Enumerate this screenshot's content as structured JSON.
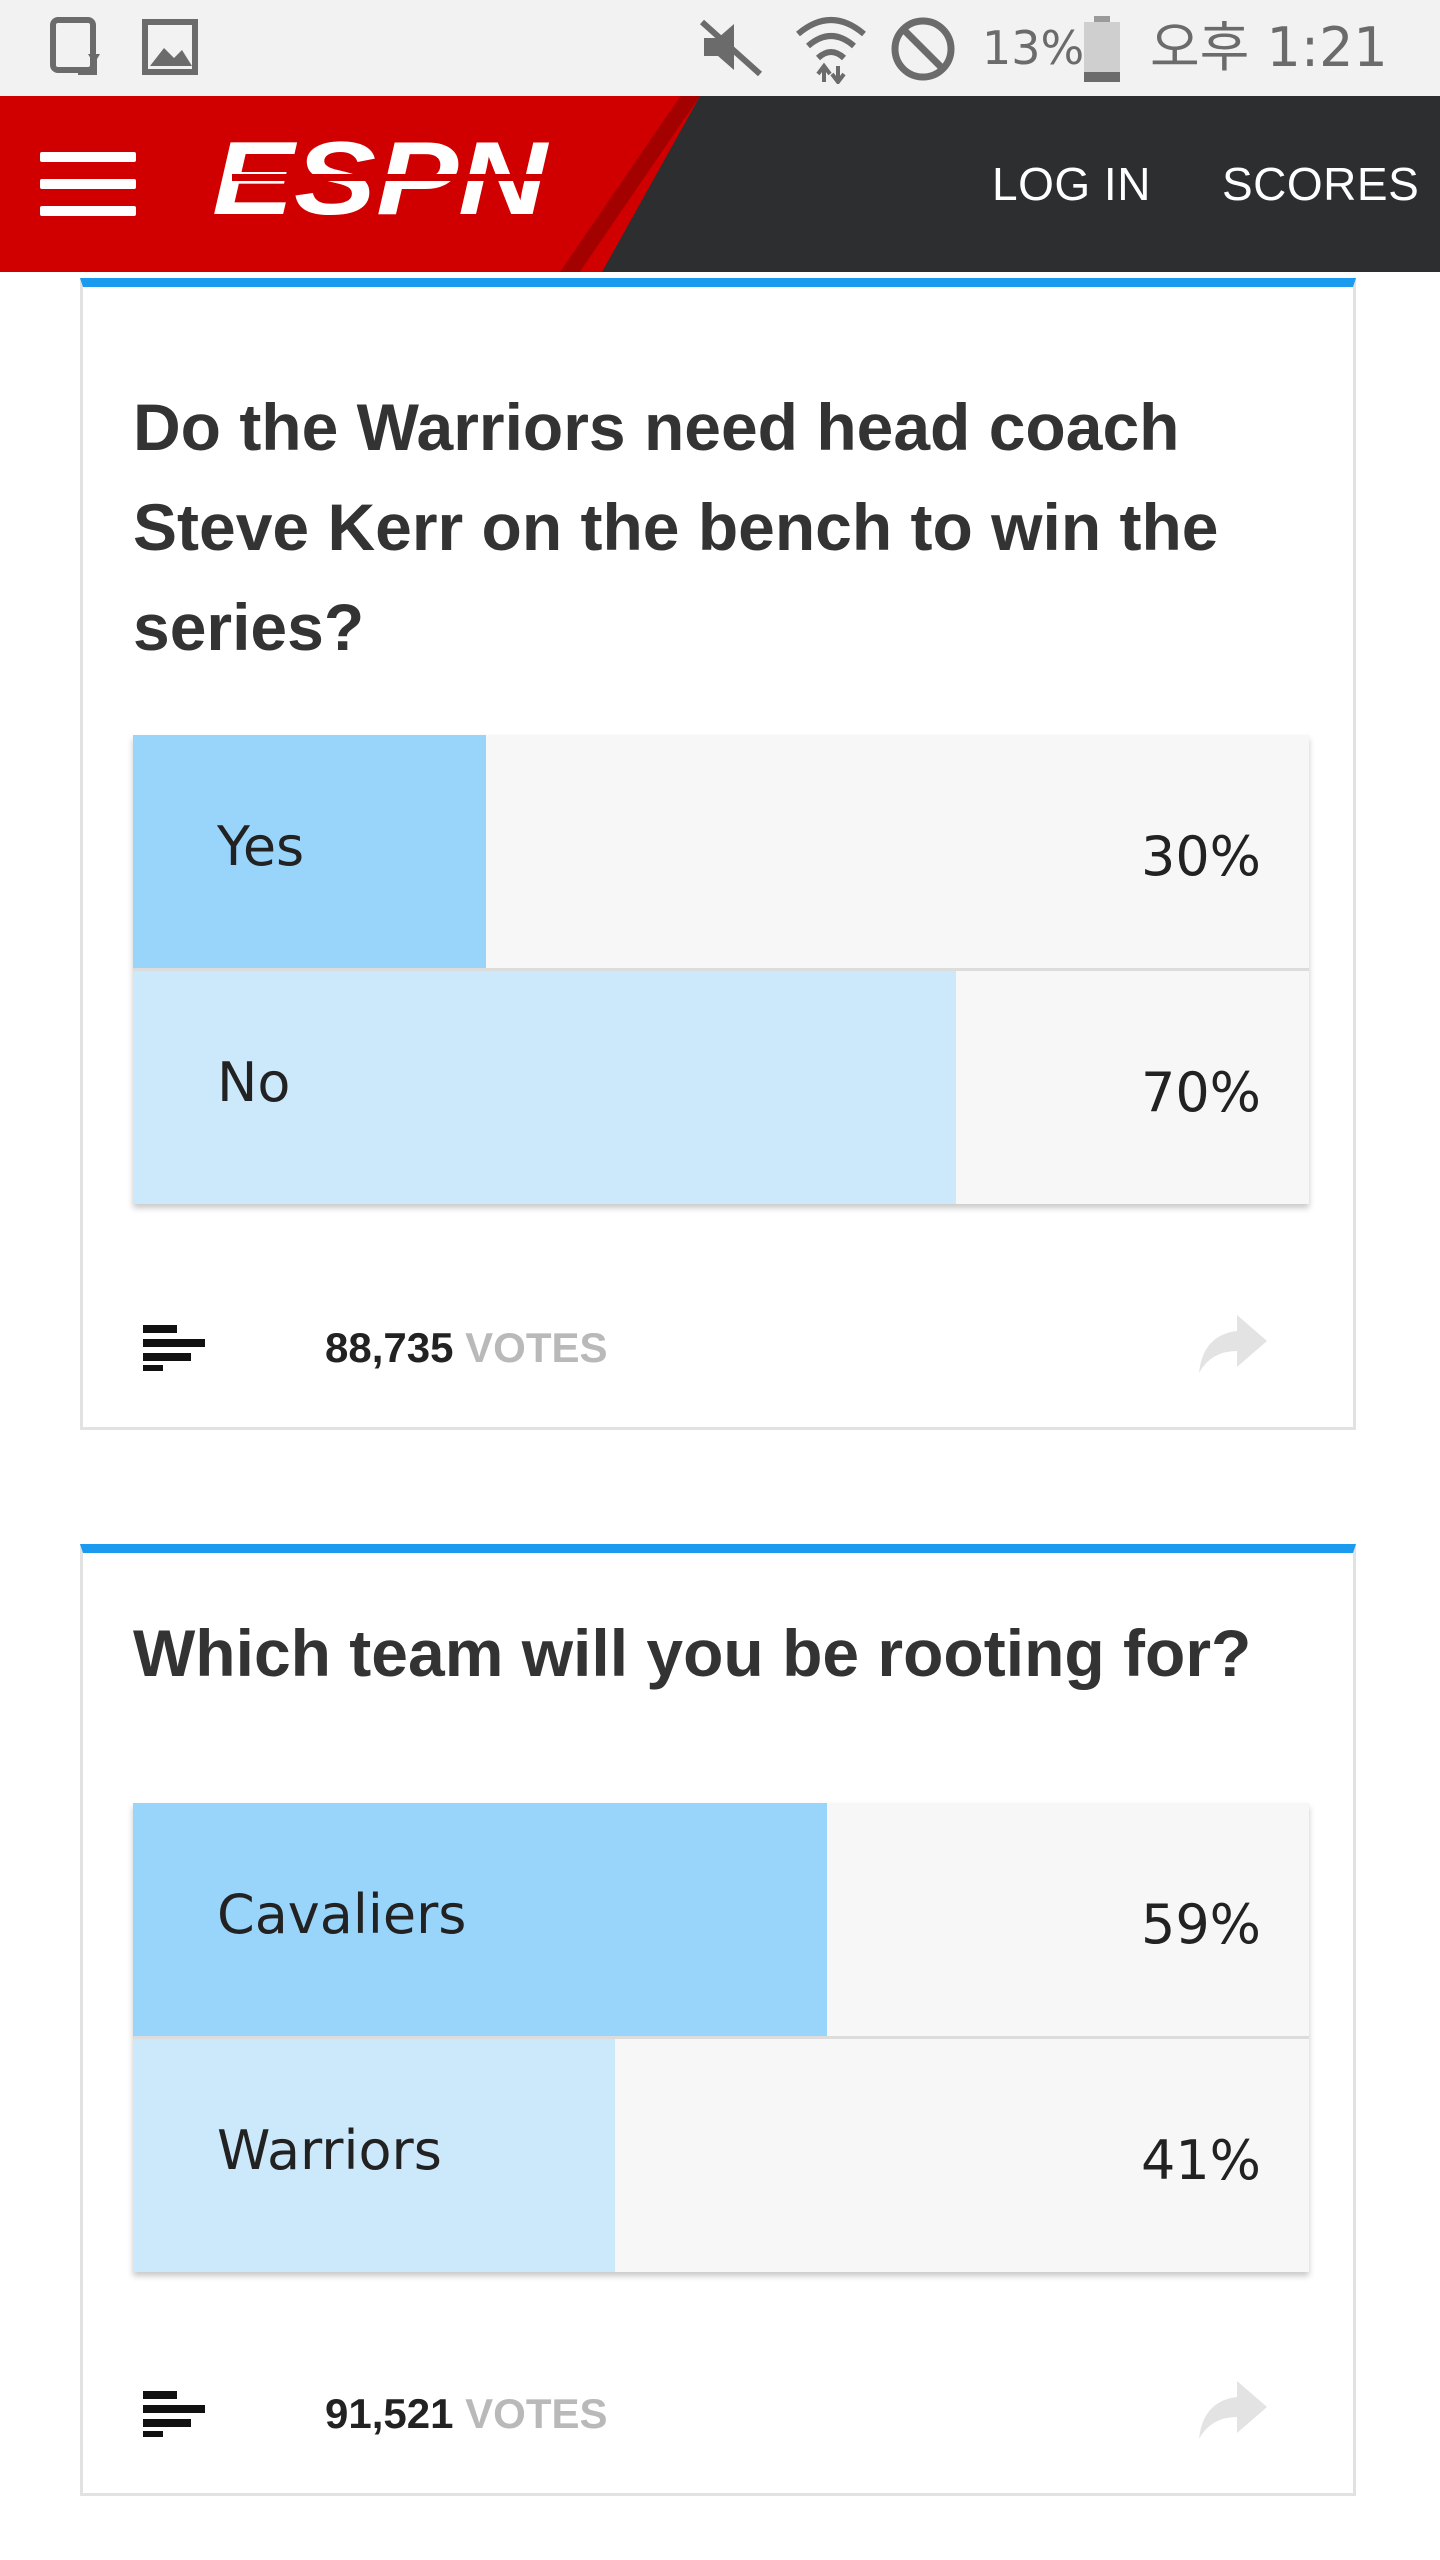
{
  "status_bar": {
    "battery": "13%",
    "time": "오후 1:21",
    "icons": [
      "screen-rotate-icon",
      "image-icon",
      "mute-icon",
      "wifi-icon",
      "do-not-disturb-icon",
      "battery-icon"
    ]
  },
  "header": {
    "logo_text": "ESPN",
    "login": "LOG IN",
    "scores": "SCORES",
    "colors": {
      "red": "#d00000",
      "dark": "#2d2e30"
    }
  },
  "polls": [
    {
      "question": "Do the Warriors need head coach Steve Kerr on the bench to win the series?",
      "options": [
        {
          "label": "Yes",
          "percent": "30%",
          "fill_fraction": 0.3,
          "color": "#99d4fb"
        },
        {
          "label": "No",
          "percent": "70%",
          "fill_fraction": 0.7,
          "color": "#cce9fc"
        }
      ],
      "vote_count": "88,735",
      "votes_label": "VOTES"
    },
    {
      "question": "Which team will you be rooting for?",
      "options": [
        {
          "label": "Cavaliers",
          "percent": "59%",
          "fill_fraction": 0.59,
          "color": "#99d4fb"
        },
        {
          "label": "Warriors",
          "percent": "41%",
          "fill_fraction": 0.41,
          "color": "#cce9fc"
        }
      ],
      "vote_count": "91,521",
      "votes_label": "VOTES"
    }
  ]
}
